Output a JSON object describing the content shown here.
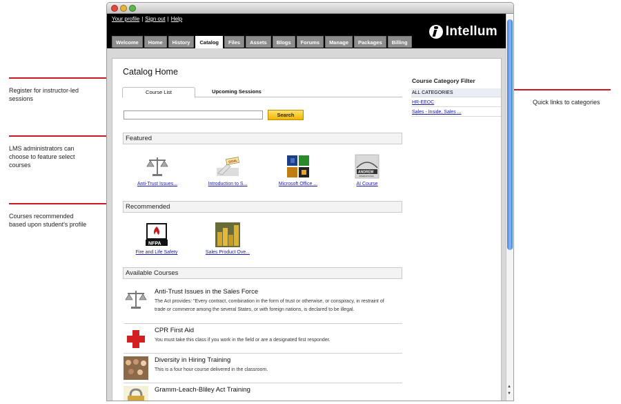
{
  "annotations": {
    "register": "Register for instructor-led sessions",
    "featured": "LMS administrators can choose to feature select courses",
    "recommended": "Courses recommended based upon student's profile",
    "quicklinks": "Quick links to categories"
  },
  "header": {
    "links": [
      "Your profile",
      "Sign out",
      "Help"
    ],
    "separator": "|",
    "brand": "Intellum"
  },
  "nav_tabs": [
    {
      "label": "Welcome"
    },
    {
      "label": "Home"
    },
    {
      "label": "History"
    },
    {
      "label": "Catalog"
    },
    {
      "label": "Files"
    },
    {
      "label": "Assets"
    },
    {
      "label": "Blogs"
    },
    {
      "label": "Forums"
    },
    {
      "label": "Manage"
    },
    {
      "label": "Packages"
    },
    {
      "label": "Billing"
    }
  ],
  "page": {
    "title": "Catalog Home",
    "subtabs": [
      "Course List",
      "Upcoming Sessions"
    ],
    "search": {
      "value": "",
      "button": "Search"
    }
  },
  "sections": {
    "featured": "Featured",
    "recommended": "Recommended",
    "available": "Available Courses"
  },
  "featured": [
    {
      "caption": "Anti-Trust Issues..."
    },
    {
      "caption": "Introduction to S..."
    },
    {
      "caption": "Microsoft Office ..."
    },
    {
      "caption": "AI Course"
    }
  ],
  "featured_thumb_text": {
    "goal": "GOAL",
    "andrew": "ANDREW",
    "andrew_sub": "INTERNATIONAL"
  },
  "recommended": [
    {
      "caption": "Fire and Life Safety"
    },
    {
      "caption": "Sales Product Ove..."
    }
  ],
  "nfpa_text": "NFPA",
  "available": [
    {
      "title": "Anti-Trust Issues in the Sales Force",
      "desc": "The Act provides: \"Every contract, combination in the form of trust or otherwise, or conspiracy, in restraint of trade or commerce among the several States, or with foreign nations, is declared to be illegal."
    },
    {
      "title": "CPR First Aid",
      "desc": "You must take this class if you work in the field or are a designated first responder."
    },
    {
      "title": "Diversity in Hiring Training",
      "desc": "This is a four hour course delivered in the classroom."
    },
    {
      "title": "Gramm-Leach-Bliley Act Training",
      "desc": ""
    }
  ],
  "filter": {
    "title": "Course Category Filter",
    "items": [
      "ALL CATEGORIES",
      "HR-EEOC",
      "Sales - Inside, Sales ..."
    ]
  },
  "colors": {
    "accent_red": "#c8171e",
    "search_button": "#f2b400",
    "link": "#1a1aa6"
  }
}
